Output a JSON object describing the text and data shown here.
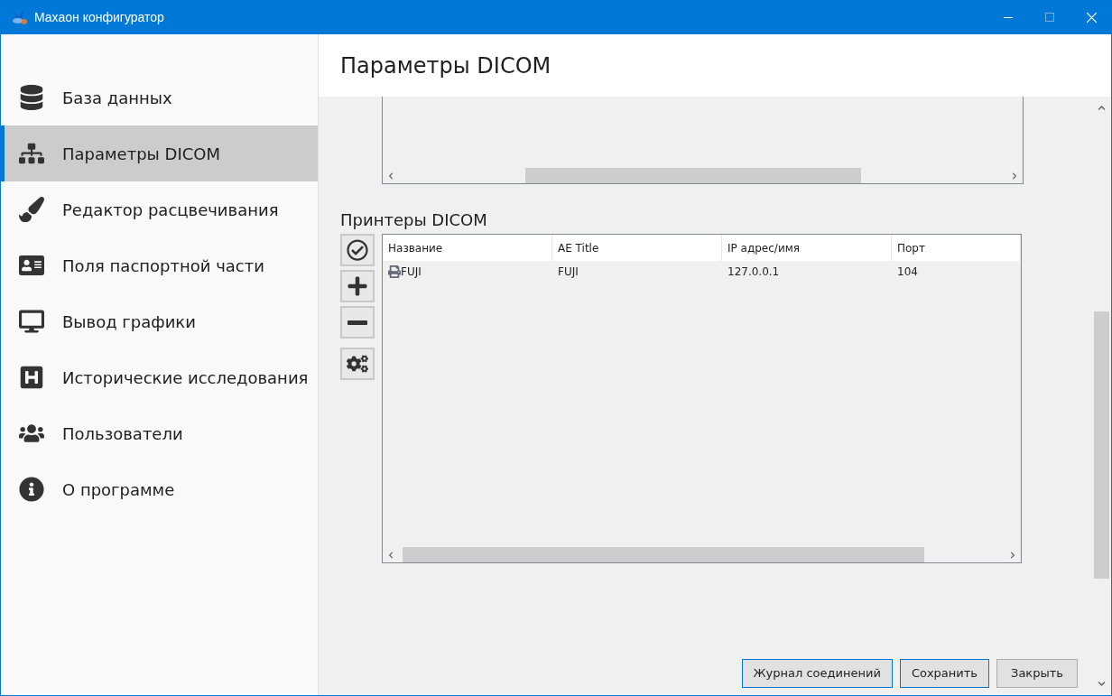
{
  "window": {
    "title": "Махаон конфигуратор"
  },
  "sidebar": {
    "items": [
      {
        "label": "База данных",
        "selected": false
      },
      {
        "label": "Параметры DICOM",
        "selected": true
      },
      {
        "label": "Редактор расцвечивания",
        "selected": false
      },
      {
        "label": "Поля паспортной части",
        "selected": false
      },
      {
        "label": "Вывод графики",
        "selected": false
      },
      {
        "label": "Исторические исследования",
        "selected": false
      },
      {
        "label": "Пользователи",
        "selected": false
      },
      {
        "label": "О программе",
        "selected": false
      }
    ]
  },
  "page_title": "Параметры DICOM",
  "printers": {
    "title": "Принтеры DICOM",
    "columns": [
      "Название",
      "AE Title",
      "IP адрес/имя",
      "Порт"
    ],
    "rows": [
      [
        "FUJI",
        "FUJI",
        "127.0.0.1",
        "104"
      ]
    ]
  },
  "buttons": [
    "Журнал соединений",
    "Сохранить",
    "Закрыть"
  ]
}
